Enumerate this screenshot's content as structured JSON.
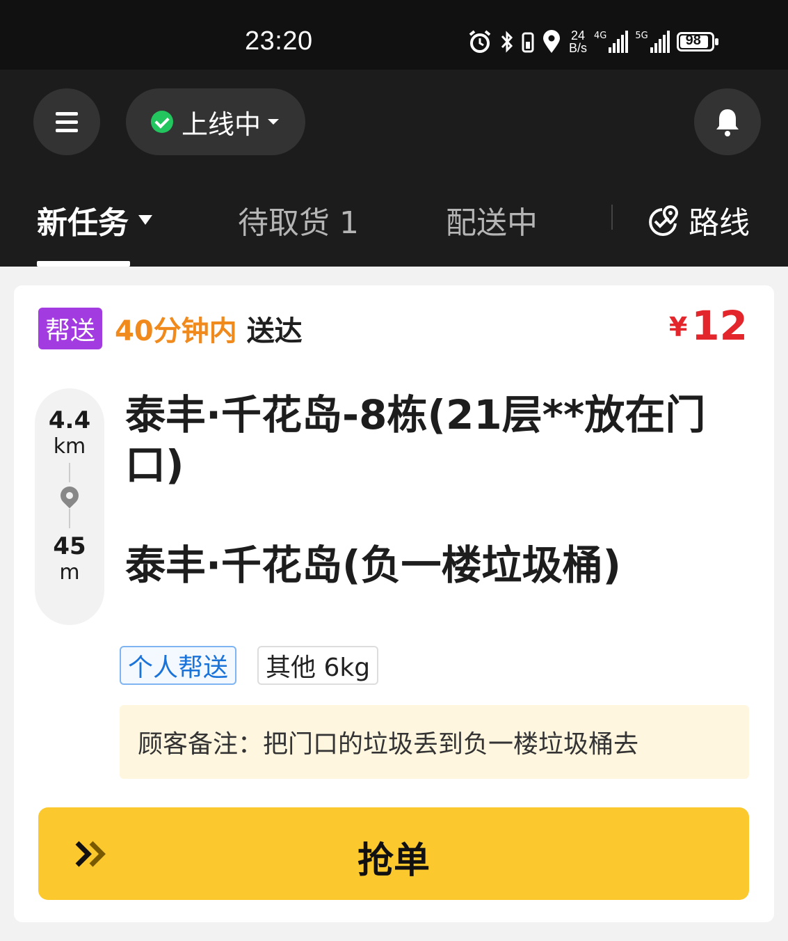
{
  "status_bar": {
    "time": "23:20",
    "net_speed_value": "24",
    "net_speed_unit": "B/s",
    "signal_4g": "4G",
    "signal_5g": "5G",
    "battery": "98"
  },
  "header": {
    "online_status": "上线中"
  },
  "tabs": {
    "new_tasks": "新任务",
    "pickup": "待取货 1",
    "delivering": "配送中",
    "route": "路线"
  },
  "order": {
    "type_badge": "帮送",
    "eta": "40分钟内",
    "eta_suffix": "送达",
    "currency": "¥",
    "price": "12",
    "distance_pickup_value": "4.4",
    "distance_pickup_unit": "km",
    "distance_delivery_value": "45",
    "distance_delivery_unit": "m",
    "pickup_address": "泰丰·千花岛-8栋(21层**放在门口)",
    "delivery_address": "泰丰·千花岛(负一楼垃圾桶)",
    "tags": [
      "个人帮送",
      "其他 6kg"
    ],
    "note": "顾客备注：把门口的垃圾丢到负一楼垃圾桶去",
    "grab_button": "抢单"
  },
  "colors": {
    "accent_yellow": "#fbc82e",
    "badge_purple": "#a23be0",
    "eta_orange": "#f08a1c",
    "price_red": "#e3262b",
    "online_green": "#22c55e"
  }
}
